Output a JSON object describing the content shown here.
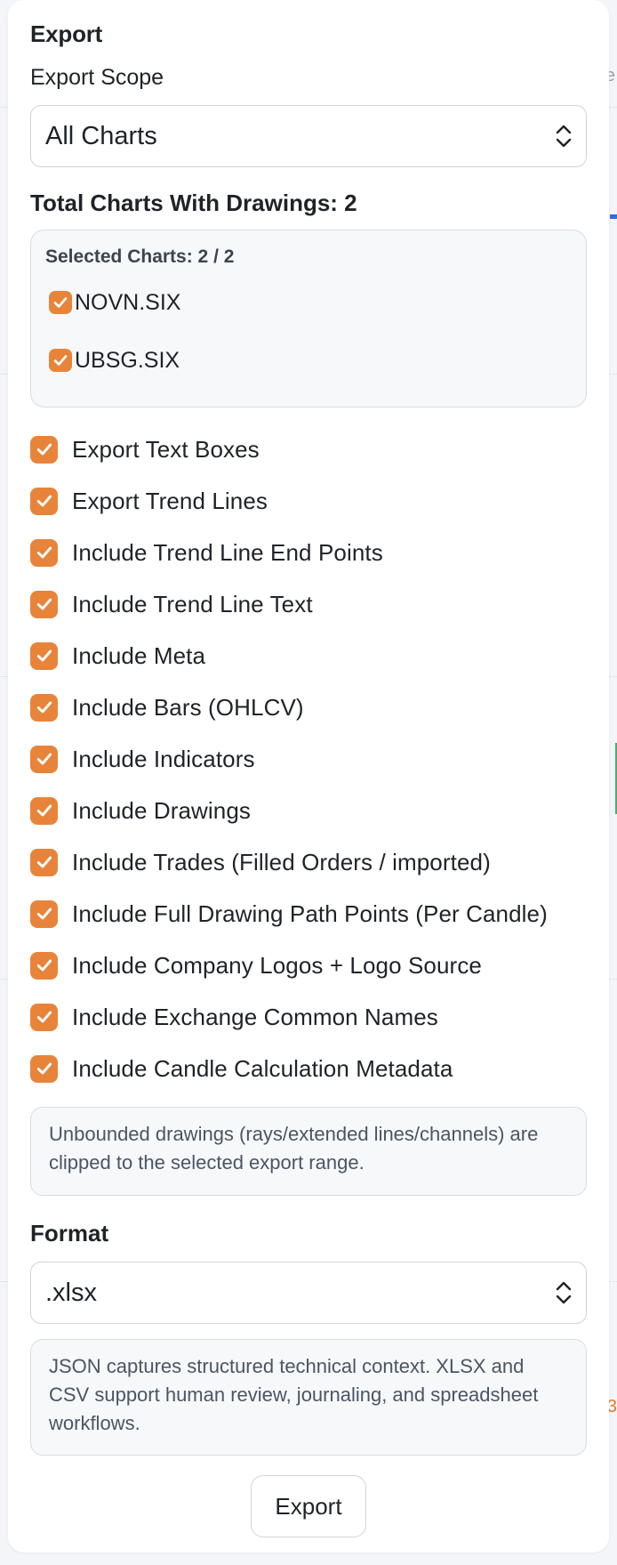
{
  "panel": {
    "title": "Export",
    "scope_label": "Export Scope",
    "scope_value": "All Charts",
    "total_label": "Total Charts With Drawings: 2",
    "selected_header": "Selected Charts: 2 / 2",
    "charts": [
      {
        "label": "NOVN.SIX",
        "checked": true
      },
      {
        "label": "UBSG.SIX",
        "checked": true
      }
    ],
    "options": [
      {
        "label": "Export Text Boxes",
        "checked": true
      },
      {
        "label": "Export Trend Lines",
        "checked": true
      },
      {
        "label": "Include Trend Line End Points",
        "checked": true
      },
      {
        "label": "Include Trend Line Text",
        "checked": true
      },
      {
        "label": "Include Meta",
        "checked": true
      },
      {
        "label": "Include Bars (OHLCV)",
        "checked": true
      },
      {
        "label": "Include Indicators",
        "checked": true
      },
      {
        "label": "Include Drawings",
        "checked": true
      },
      {
        "label": "Include Trades (Filled Orders / imported)",
        "checked": true
      },
      {
        "label": "Include Full Drawing Path Points (Per Candle)",
        "checked": true
      },
      {
        "label": "Include Company Logos + Logo Source",
        "checked": true
      },
      {
        "label": "Include Exchange Common Names",
        "checked": true
      },
      {
        "label": "Include Candle Calculation Metadata",
        "checked": true
      }
    ],
    "clip_note": "Unbounded drawings (rays/extended lines/channels) are clipped to the selected export range.",
    "format_label": "Format",
    "format_value": ".xlsx",
    "format_note": "JSON captures structured technical context. XLSX and CSV support human review, journaling, and spreadsheet workflows.",
    "export_button": "Export"
  },
  "colors": {
    "accent": "#e8843a",
    "panel_bg": "#ffffff",
    "box_bg": "#f6f8fa"
  },
  "icons": {
    "checkbox": "checkmark-icon",
    "select": "chevron-up-down-icon"
  },
  "background": {
    "edge_text": "e",
    "edge_text_2": "3"
  }
}
